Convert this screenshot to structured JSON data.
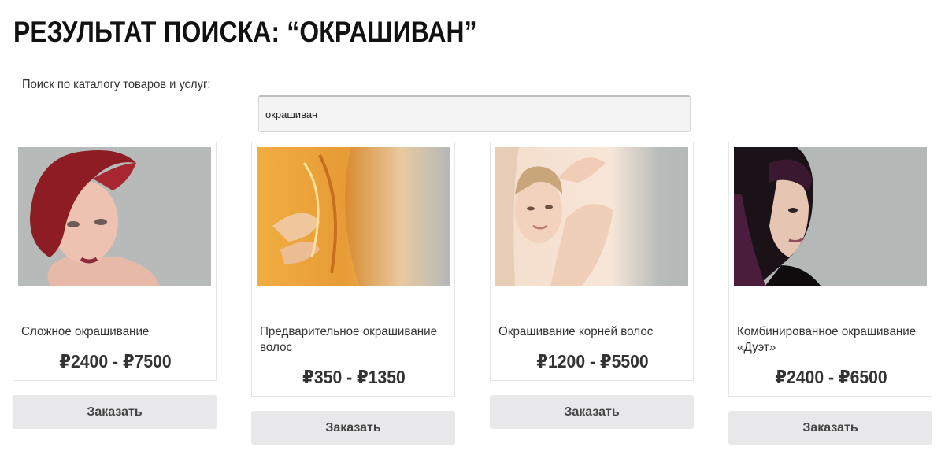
{
  "page": {
    "title": "РЕЗУЛЬТАТ ПОИСКА: “ОКРАШИВАН”"
  },
  "search": {
    "label": "Поиск по каталогу товаров и услуг:",
    "value": "окрашиван"
  },
  "products": [
    {
      "name": "Сложное окрашивание",
      "price": "₽2400 - ₽7500",
      "button": "Заказать",
      "image": "red-hair-woman"
    },
    {
      "name": "Предварительное окрашивание волос",
      "price": "₽350 - ₽1350",
      "button": "Заказать",
      "image": "golden-hair-closeup"
    },
    {
      "name": "Окрашивание корней волос",
      "price": "₽1200 - ₽5500",
      "button": "Заказать",
      "image": "smiling-woman"
    },
    {
      "name": "Комбинированное окрашивание «Дуэт»",
      "price": "₽2400 - ₽6500",
      "button": "Заказать",
      "image": "dark-bob-woman"
    }
  ],
  "colors": {
    "button_bg": "#e8e8ea",
    "image_bg": "#b4b9b8"
  }
}
